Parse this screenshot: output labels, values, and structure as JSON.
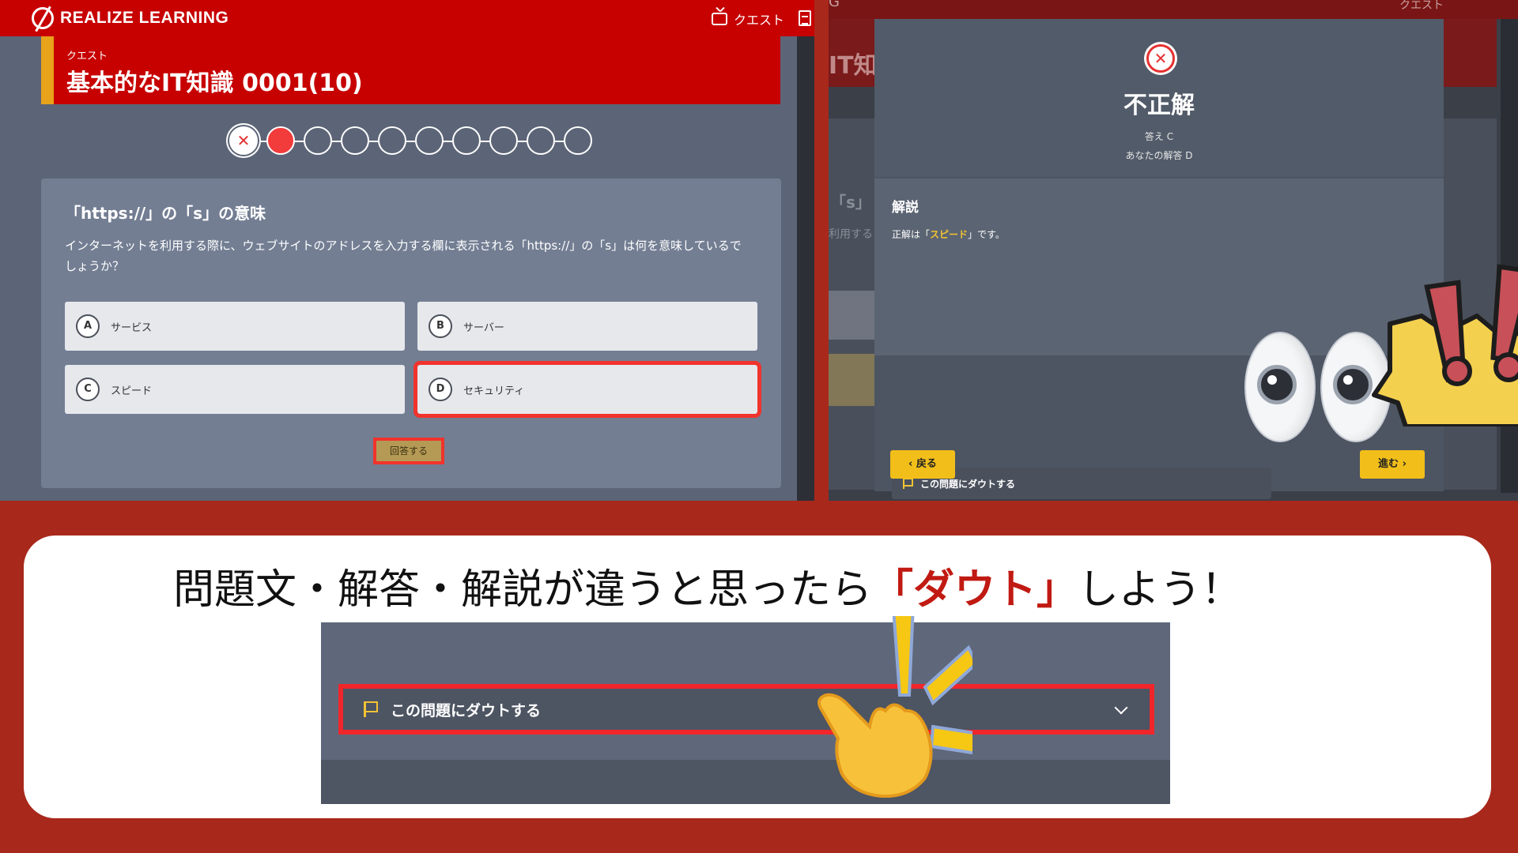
{
  "left": {
    "logo": "REALIZE LEARNING",
    "topbar_quest": "クエスト",
    "quest_label": "クエスト",
    "quest_title": "基本的なIT知識 0001(10)",
    "progress_wrong_mark": "✕",
    "question": {
      "title": "「https://」の「s」の意味",
      "body": "インターネットを利用する際に、ウェブサイトのアドレスを入力する欄に表示される「https://」の「s」は何を意味しているでしょうか？",
      "options": [
        {
          "letter": "A",
          "text": "サービス"
        },
        {
          "letter": "B",
          "text": "サーバー"
        },
        {
          "letter": "C",
          "text": "スピード"
        },
        {
          "letter": "D",
          "text": "セキュリティ"
        }
      ],
      "answer_button": "回答する"
    }
  },
  "right": {
    "topbar_ghost": "G",
    "topbar_quest_ghost": "クエスト",
    "banner_ghost": "IT知",
    "ghost_s": "「s」",
    "ghost_riyou": "利用する",
    "result_mark": "✕",
    "result_title": "不正解",
    "answer_line": "答え C",
    "your_answer_line": "あなたの解答 D",
    "explain_title": "解説",
    "explain_prefix": "正解は「",
    "explain_highlight": "スピード",
    "explain_suffix": "」です。",
    "doubt_label": "この問題にダウトする",
    "back_button": "‹ 戻る",
    "next_button": "進む ›"
  },
  "bottom": {
    "headline_prefix": "問題文・解答・解説が違うと思ったら",
    "headline_accent": "「ダウト」",
    "headline_suffix": "しよう！",
    "doubt_label": "この問題にダウトする"
  },
  "colors": {
    "brand_red": "#c70000",
    "accent_yellow": "#f2bf1a",
    "background_red": "#a8281b",
    "highlight_red": "#f0262a"
  }
}
